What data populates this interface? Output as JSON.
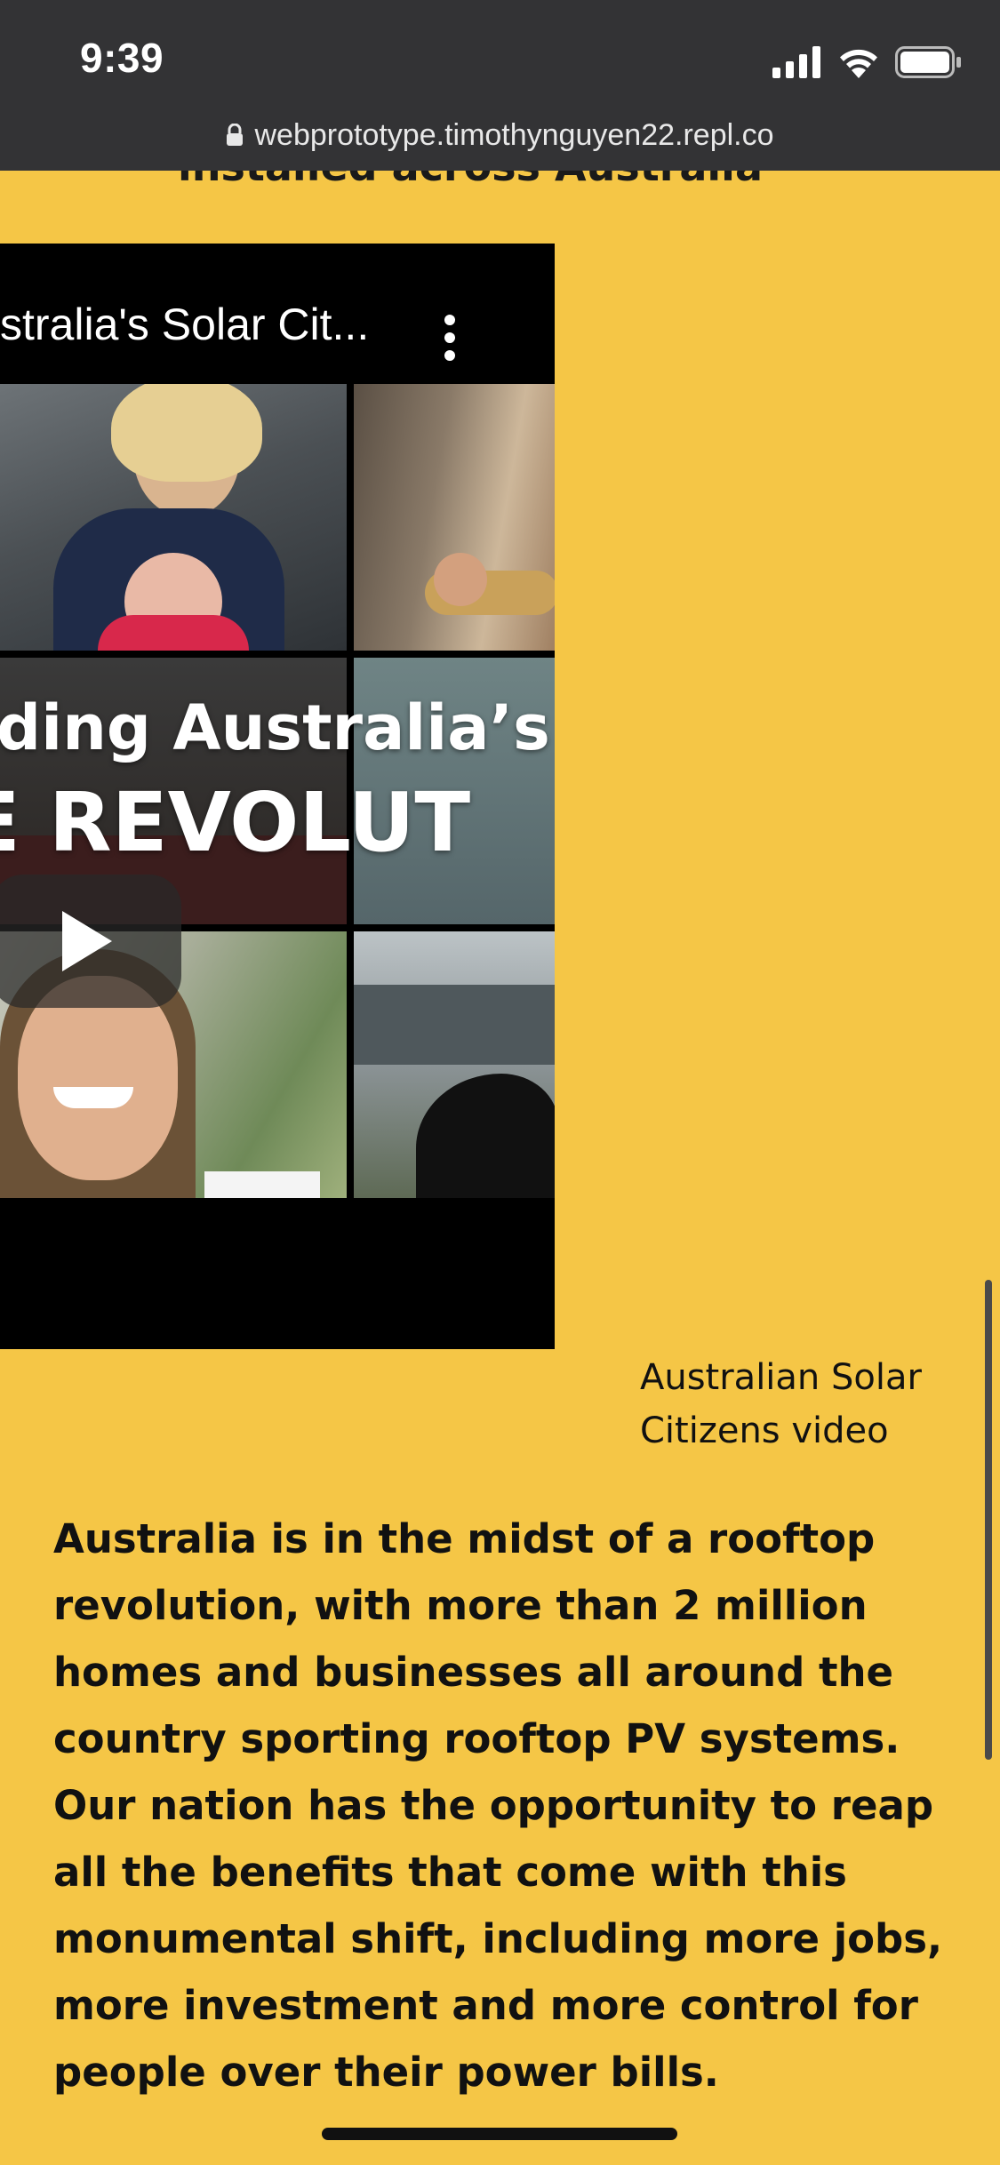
{
  "status_bar": {
    "time": "9:39",
    "icons": [
      "cellular-signal-icon",
      "wifi-icon",
      "battery-icon"
    ]
  },
  "browser": {
    "url": "webprototype.timothynguyen22.repl.co",
    "lock_icon": "lock-icon"
  },
  "page": {
    "cutoff_heading": "installed across Australia",
    "video": {
      "title": "stralia's Solar Cit...",
      "menu_icon": "more-vertical-icon",
      "overlay_line_1": "ding Australia’s",
      "overlay_line_2": "E REVOLUT",
      "play_icon": "play-icon"
    },
    "video_caption": "Australian Solar Citizens video",
    "body_paragraph": "Australia is in the midst of a rooftop revolution, with more than 2 million homes and businesses all around the country sporting rooftop PV systems. Our nation has the opportunity to reap all the benefits that come with this monumental shift, including more jobs, more investment and more control for people over their power bills."
  },
  "colors": {
    "page_background": "#f5c646",
    "browser_chrome": "#333335",
    "text": "#111111"
  }
}
